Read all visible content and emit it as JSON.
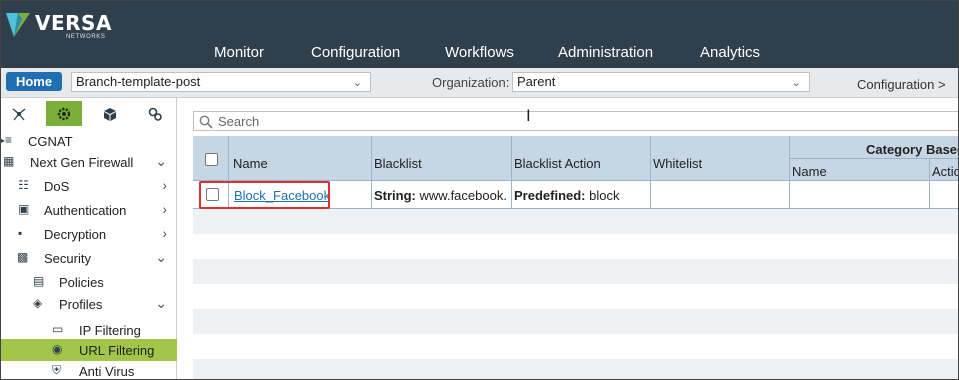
{
  "brand": {
    "name": "VERSA",
    "sub": "NETWORKS"
  },
  "nav": [
    "Monitor",
    "Configuration",
    "Workflows",
    "Administration",
    "Analytics"
  ],
  "toolbar": {
    "home_label": "Home",
    "template_value": "Branch-template-post",
    "org_label": "Organization:",
    "org_value": "Parent",
    "breadcrumb": "Configuration  >"
  },
  "sidebar": {
    "tabs": [
      "network-icon",
      "gear-icon",
      "box-icon",
      "settings-icon"
    ],
    "items": [
      {
        "label": "CGNAT",
        "icon": "cgnat-icon"
      },
      {
        "label": "Next Gen Firewall",
        "icon": "firewall-icon"
      },
      {
        "label": "DoS",
        "icon": "dos-icon"
      },
      {
        "label": "Authentication",
        "icon": "auth-icon"
      },
      {
        "label": "Decryption",
        "icon": "lock-icon"
      },
      {
        "label": "Security",
        "icon": "security-icon"
      },
      {
        "label": "Policies",
        "icon": "policies-icon"
      },
      {
        "label": "Profiles",
        "icon": "profiles-icon"
      },
      {
        "label": "IP Filtering",
        "icon": "ip-filter-icon"
      },
      {
        "label": "URL Filtering",
        "icon": "url-filter-icon",
        "selected": true
      },
      {
        "label": "Anti Virus",
        "icon": "antivirus-icon"
      }
    ]
  },
  "search": {
    "placeholder": "Search"
  },
  "table": {
    "headers": {
      "name": "Name",
      "blacklist": "Blacklist",
      "blacklist_action": "Blacklist Action",
      "whitelist": "Whitelist",
      "category_group": "Category Based A",
      "cat_name": "Name",
      "cat_action": "Actio"
    },
    "rows": [
      {
        "name": "Block_Facebook",
        "blacklist_prefix": "String:",
        "blacklist_value": "www.facebook....",
        "action_prefix": "Predefined:",
        "action_value": "block"
      }
    ]
  },
  "colors": {
    "topbar": "#2f3f4c",
    "accent_green": "#7ab03a",
    "selected_green": "#a3c64a",
    "home_blue": "#1f6fb2",
    "header_blue": "#c7d6e4",
    "highlight_red": "#d83333"
  }
}
